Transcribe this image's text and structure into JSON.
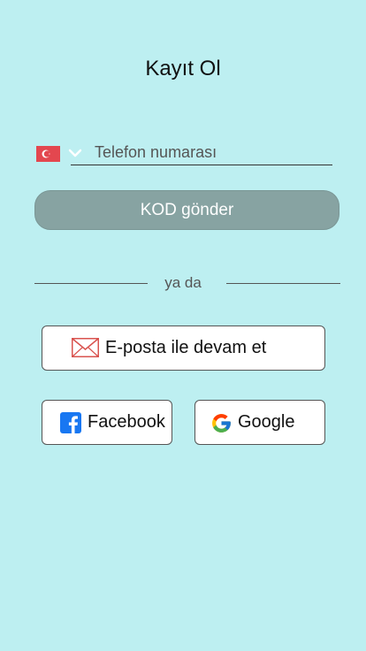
{
  "page": {
    "title": "Kayıt Ol"
  },
  "phone": {
    "country_flag": "turkey-flag-icon",
    "placeholder": "Telefon numarası"
  },
  "send_code": {
    "label": "KOD gönder"
  },
  "divider": {
    "text": "ya da"
  },
  "email_button": {
    "label": "E-posta ile devam et",
    "icon": "email-icon"
  },
  "facebook_button": {
    "label": "Facebook",
    "icon": "facebook-icon"
  },
  "google_button": {
    "label": "Google",
    "icon": "google-icon"
  },
  "colors": {
    "background": "#bdeff1",
    "send_button": "#87a3a2",
    "flag_red": "#e3474f",
    "facebook_blue": "#1877f2"
  }
}
